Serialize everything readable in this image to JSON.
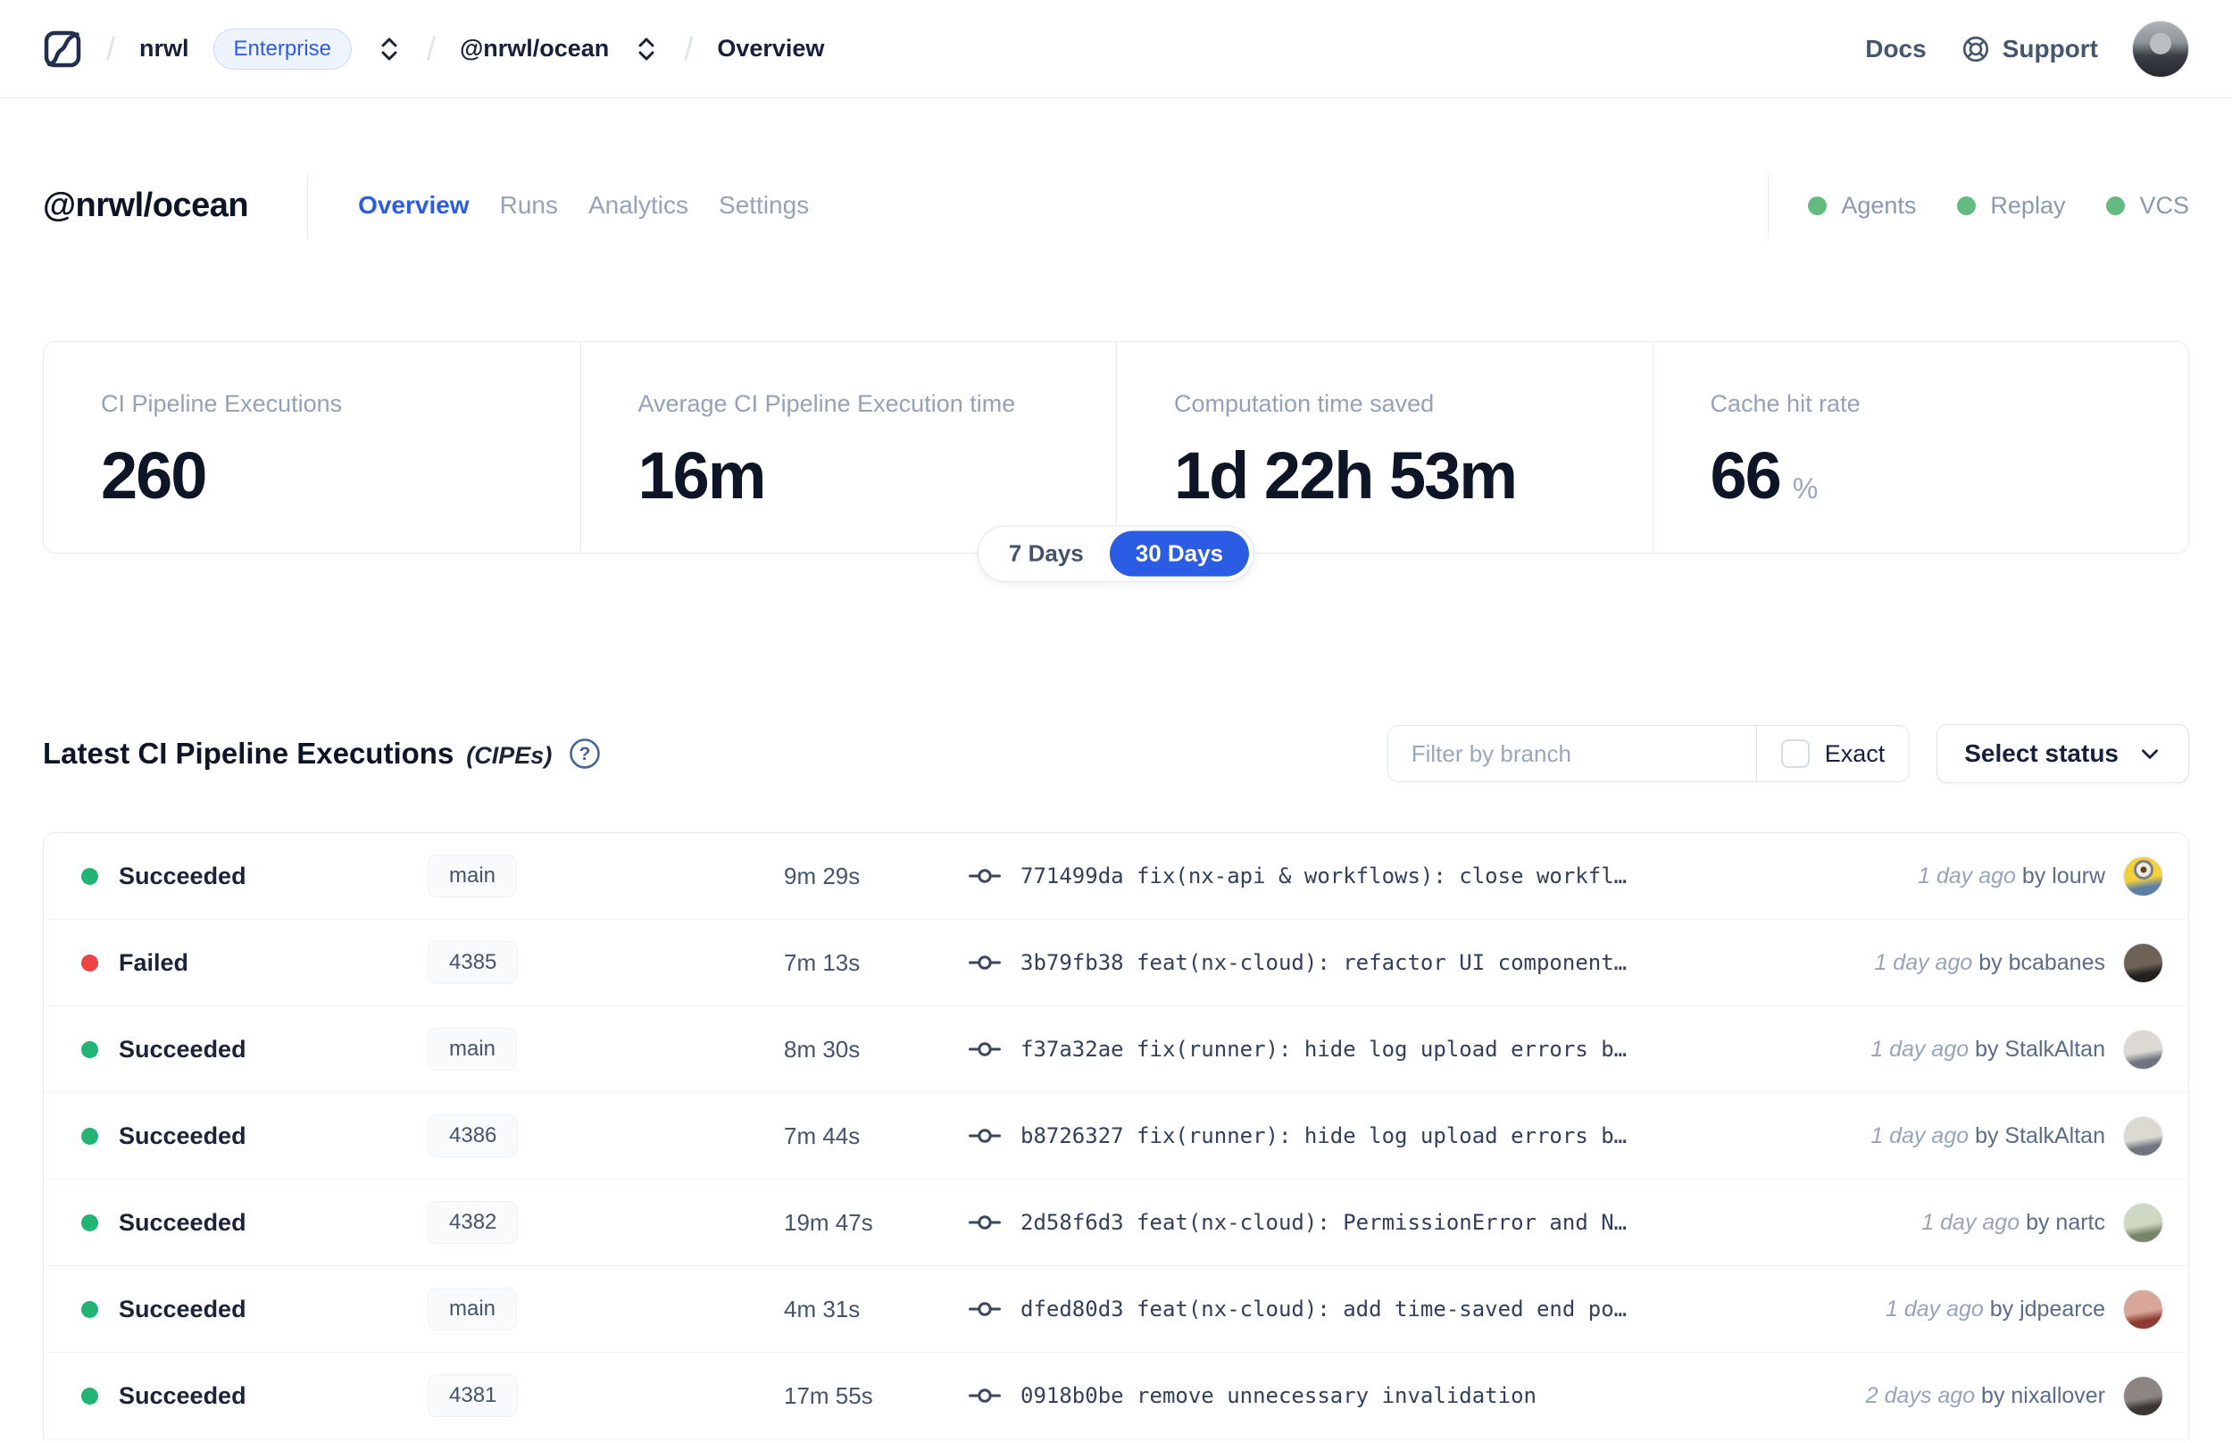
{
  "colors": {
    "accent": "#2b5ce4",
    "success": "#22b473",
    "danger": "#ee4245",
    "indicator_green": "#63bb82"
  },
  "header": {
    "breadcrumb": {
      "org": "nrwl",
      "badge": "Enterprise",
      "workspace": "@nrwl/ocean",
      "page": "Overview"
    },
    "nav": {
      "docs": "Docs",
      "support": "Support"
    }
  },
  "workspace": {
    "title": "@nrwl/ocean",
    "tabs": [
      {
        "label": "Overview",
        "active": true
      },
      {
        "label": "Runs",
        "active": false
      },
      {
        "label": "Analytics",
        "active": false
      },
      {
        "label": "Settings",
        "active": false
      }
    ],
    "indicators": [
      {
        "label": "Agents"
      },
      {
        "label": "Replay"
      },
      {
        "label": "VCS"
      }
    ]
  },
  "stats": {
    "cards": [
      {
        "label": "CI Pipeline Executions",
        "value": "260",
        "suffix": ""
      },
      {
        "label": "Average CI Pipeline Execution time",
        "value": "16m",
        "suffix": ""
      },
      {
        "label": "Computation time saved",
        "value": "1d 22h 53m",
        "suffix": ""
      },
      {
        "label": "Cache hit rate",
        "value": "66",
        "suffix": "%"
      }
    ],
    "range_toggle": {
      "options": [
        "7 Days",
        "30 Days"
      ],
      "selected": "30 Days"
    }
  },
  "cipe_section": {
    "title": "Latest CI Pipeline Executions",
    "title_suffix": "(CIPEs)",
    "filter_placeholder": "Filter by branch",
    "exact_label": "Exact",
    "select_status_label": "Select status"
  },
  "table": {
    "rows": [
      {
        "status": "Succeeded",
        "status_color": "success",
        "branch": "main",
        "duration": "9m 29s",
        "commit": "771499da fix(nx-api & workflows): close workfl…",
        "time": "1 day ago",
        "author": "by lourw",
        "avatar": {
          "kind": "minion",
          "from": "#f4d03d",
          "to": "#5d7fa7"
        }
      },
      {
        "status": "Failed",
        "status_color": "danger",
        "branch": "4385",
        "duration": "7m 13s",
        "commit": "3b79fb38 feat(nx-cloud): refactor UI component…",
        "time": "1 day ago",
        "author": "by bcabanes",
        "avatar": {
          "kind": "photo",
          "from": "#6e6257",
          "to": "#23201e"
        }
      },
      {
        "status": "Succeeded",
        "status_color": "success",
        "branch": "main",
        "duration": "8m 30s",
        "commit": "f37a32ae fix(runner): hide log upload errors b…",
        "time": "1 day ago",
        "author": "by StalkAltan",
        "avatar": {
          "kind": "photo",
          "from": "#dcd9d3",
          "to": "#6f767d"
        }
      },
      {
        "status": "Succeeded",
        "status_color": "success",
        "branch": "4386",
        "duration": "7m 44s",
        "commit": "b8726327 fix(runner): hide log upload errors b…",
        "time": "1 day ago",
        "author": "by StalkAltan",
        "avatar": {
          "kind": "photo",
          "from": "#dcd9d3",
          "to": "#6f767d"
        }
      },
      {
        "status": "Succeeded",
        "status_color": "success",
        "branch": "4382",
        "duration": "19m 47s",
        "commit": "2d58f6d3 feat(nx-cloud): PermissionError and N…",
        "time": "1 day ago",
        "author": "by nartc",
        "avatar": {
          "kind": "photo",
          "from": "#cfd8c2",
          "to": "#77856a"
        }
      },
      {
        "status": "Succeeded",
        "status_color": "success",
        "branch": "main",
        "duration": "4m 31s",
        "commit": "dfed80d3 feat(nx-cloud): add time-saved end po…",
        "time": "1 day ago",
        "author": "by jdpearce",
        "avatar": {
          "kind": "photo",
          "from": "#d9a79a",
          "to": "#8e3b33"
        }
      },
      {
        "status": "Succeeded",
        "status_color": "success",
        "branch": "4381",
        "duration": "17m 55s",
        "commit": "0918b0be remove unnecessary invalidation",
        "time": "2 days ago",
        "author": "by nixallover",
        "avatar": {
          "kind": "photo",
          "from": "#8c8582",
          "to": "#3b3533"
        }
      }
    ]
  }
}
